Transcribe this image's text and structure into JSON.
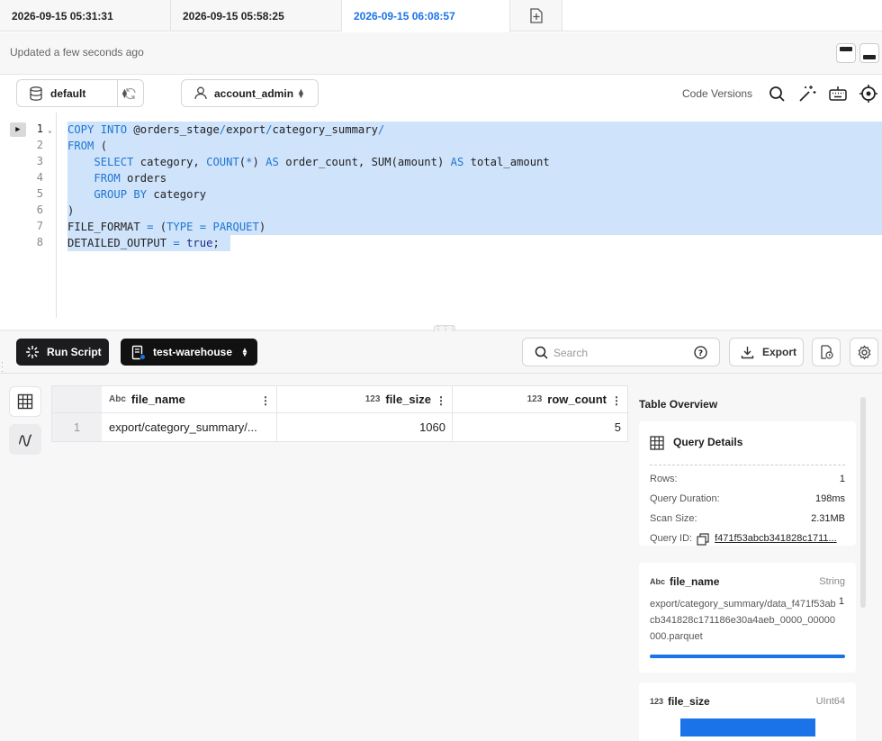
{
  "tabs": [
    "2026-09-15 05:31:31",
    "2026-09-15 05:58:25",
    "2026-09-15 06:08:57"
  ],
  "status": {
    "updated_text": "Updated a few seconds ago"
  },
  "toolbar": {
    "database": "default",
    "role": "account_admin",
    "code_versions": "Code Versions"
  },
  "editor": {
    "line_numbers": [
      "1",
      "2",
      "3",
      "4",
      "5",
      "6",
      "7",
      "8"
    ]
  },
  "results_toolbar": {
    "run_label": "Run Script",
    "warehouse": "test-warehouse",
    "search_placeholder": "Search",
    "export_label": "Export"
  },
  "grid": {
    "type_text": "Abc",
    "type_num": "123",
    "columns": [
      "file_name",
      "file_size",
      "row_count"
    ],
    "rows": [
      {
        "num": "1",
        "file_name": "export/category_summary/...",
        "file_size": "1060",
        "row_count": "5"
      }
    ]
  },
  "overview": {
    "title": "Table Overview",
    "query_details": {
      "title": "Query Details",
      "rows_label": "Rows:",
      "rows_value": "1",
      "duration_label": "Query Duration:",
      "duration_value": "198ms",
      "scan_label": "Scan Size:",
      "scan_value": "2.31MB",
      "qid_label": "Query ID:",
      "qid_value": "f471f53abcb341828c1711..."
    },
    "file_name_card": {
      "type_badge": "Abc",
      "name": "file_name",
      "type": "String",
      "value": "export/category_summary/data_f471f53abcb341828c171186e30a4aeb_0000_00000000.parquet",
      "count": "1"
    },
    "file_size_card": {
      "type_badge": "123",
      "name": "file_size",
      "type": "UInt64"
    }
  },
  "colors": {
    "accent": "#1a73e8",
    "keyword": "#1f76d2",
    "selection": "#cfe3fb",
    "dark_button": "#1c1c1e"
  }
}
